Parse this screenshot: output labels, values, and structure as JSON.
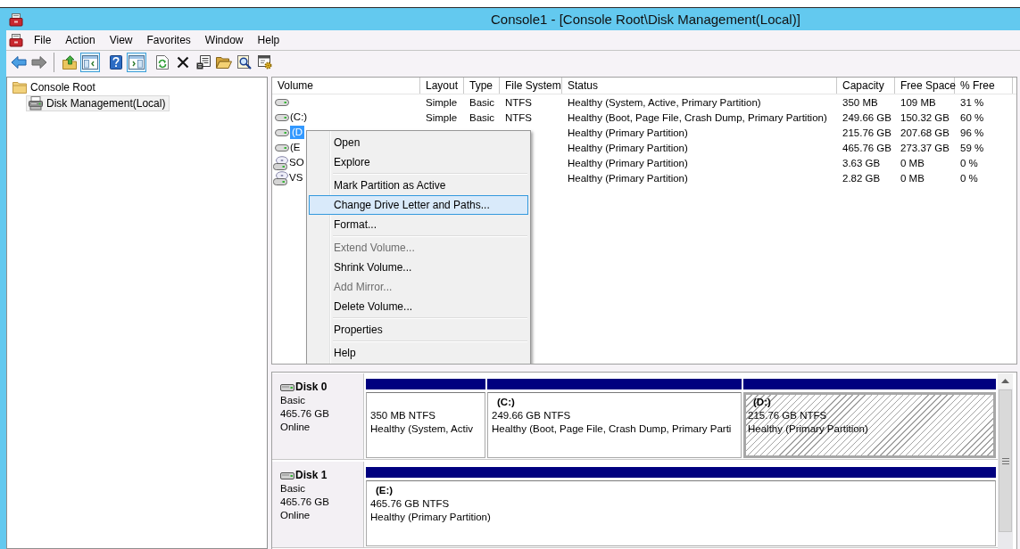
{
  "window": {
    "title": "Console1 - [Console Root\\Disk Management(Local)]"
  },
  "menu_bar": {
    "items": [
      "File",
      "Action",
      "View",
      "Favorites",
      "Window",
      "Help"
    ]
  },
  "toolbar": {
    "groups": [
      [
        {
          "disabled": false,
          "pressed": false
        },
        {
          "disabled": true,
          "pressed": false
        }
      ],
      [
        {
          "disabled": false,
          "pressed": false
        },
        {
          "disabled": false,
          "pressed": true
        }
      ],
      [
        {
          "disabled": false,
          "pressed": false
        },
        {
          "disabled": false,
          "pressed": true
        }
      ],
      [
        {
          "disabled": false,
          "pressed": false
        },
        {
          "disabled": false,
          "pressed": false
        },
        {
          "disabled": false,
          "pressed": false
        },
        {
          "disabled": false,
          "pressed": false
        },
        {
          "disabled": false,
          "pressed": false
        },
        {
          "disabled": false,
          "pressed": false
        }
      ]
    ]
  },
  "tree": {
    "items": [
      {
        "label": "Console Root",
        "selected": false,
        "children": [
          {
            "label": "Disk Management(Local)",
            "selected": true
          }
        ]
      }
    ]
  },
  "volume_list": {
    "columns": [
      "Volume",
      "Layout",
      "Type",
      "File System",
      "Status",
      "Capacity",
      "Free Space",
      "% Free"
    ],
    "rows": [
      {
        "kind": "disk",
        "selected": false,
        "layout": "Simple",
        "type": "Basic",
        "file_system": "NTFS",
        "status": "Healthy (System, Active, Primary Partition)",
        "capacity": "350 MB",
        "free_space": "109 MB",
        "percent_free": "31 %"
      },
      {
        "kind": "disk",
        "selected": false,
        "volume": "(C:)",
        "layout": "Simple",
        "type": "Basic",
        "file_system": "NTFS",
        "status": "Healthy (Boot, Page File, Crash Dump, Primary Partition)",
        "capacity": "249.66 GB",
        "free_space": "150.32 GB",
        "percent_free": "60 %"
      },
      {
        "kind": "disk",
        "selected": true,
        "volume": "(D",
        "status": "Healthy (Primary Partition)",
        "capacity": "215.76 GB",
        "free_space": "207.68 GB",
        "percent_free": "96 %"
      },
      {
        "kind": "disk",
        "selected": false,
        "volume": "(E",
        "status": "Healthy (Primary Partition)",
        "capacity": "465.76 GB",
        "free_space": "273.37 GB",
        "percent_free": "59 %"
      },
      {
        "kind": "disc",
        "selected": false,
        "volume": "SO",
        "status": "Healthy (Primary Partition)",
        "capacity": "3.63 GB",
        "free_space": "0 MB",
        "percent_free": "0 %"
      },
      {
        "kind": "disc",
        "selected": false,
        "volume": "VS",
        "status": "Healthy (Primary Partition)",
        "capacity": "2.82 GB",
        "free_space": "0 MB",
        "percent_free": "0 %"
      }
    ]
  },
  "context_menu": {
    "items": [
      {
        "kind": "item",
        "label": "Open",
        "disabled": false,
        "selected": false
      },
      {
        "kind": "item",
        "label": "Explore",
        "disabled": false,
        "selected": false
      },
      {
        "kind": "separator"
      },
      {
        "kind": "item",
        "label": "Mark Partition as Active",
        "disabled": false,
        "selected": false
      },
      {
        "kind": "item",
        "label": "Change Drive Letter and Paths...",
        "disabled": false,
        "selected": true
      },
      {
        "kind": "item",
        "label": "Format...",
        "disabled": false,
        "selected": false
      },
      {
        "kind": "separator"
      },
      {
        "kind": "item",
        "label": "Extend Volume...",
        "disabled": true,
        "selected": false
      },
      {
        "kind": "item",
        "label": "Shrink Volume...",
        "disabled": false,
        "selected": false
      },
      {
        "kind": "item",
        "label": "Add Mirror...",
        "disabled": true,
        "selected": false
      },
      {
        "kind": "item",
        "label": "Delete Volume...",
        "disabled": false,
        "selected": false
      },
      {
        "kind": "separator"
      },
      {
        "kind": "item",
        "label": "Properties",
        "disabled": false,
        "selected": false
      },
      {
        "kind": "separator"
      },
      {
        "kind": "item",
        "label": "Help",
        "disabled": false,
        "selected": false
      }
    ]
  },
  "disks": [
    {
      "name": "Disk 0",
      "type": "Basic",
      "size": "465.76 GB",
      "status": "Online",
      "partitions": [
        {
          "size": "350 MB NTFS",
          "status": "Healthy (System, Activ",
          "selected": false
        },
        {
          "label": "(C:)",
          "size": "249.66 GB NTFS",
          "status": "Healthy (Boot, Page File, Crash Dump, Primary Parti",
          "selected": false
        },
        {
          "label": "(D:)",
          "size": "215.76 GB NTFS",
          "status": "Healthy (Primary Partition)",
          "selected": true
        }
      ]
    },
    {
      "name": "Disk 1",
      "type": "Basic",
      "size": "465.76 GB",
      "status": "Online",
      "partitions": [
        {
          "label": "(E:)",
          "size": "465.76 GB NTFS",
          "status": "Healthy (Primary Partition)",
          "selected": false
        }
      ]
    }
  ]
}
